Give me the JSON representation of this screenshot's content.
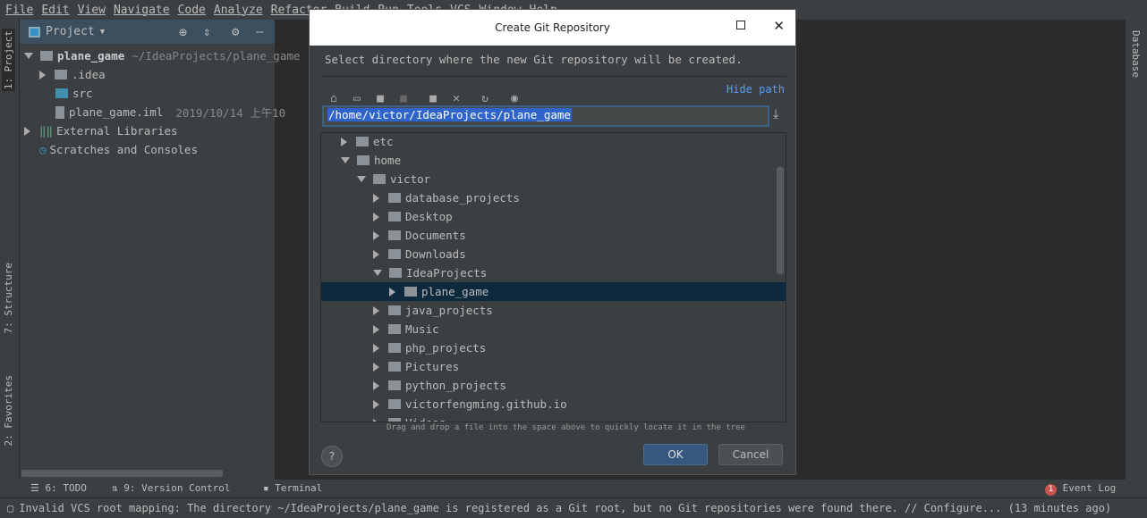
{
  "menu": [
    "File",
    "Edit",
    "View",
    "Navigate",
    "Code",
    "Analyze",
    "Refactor",
    "Build",
    "Run",
    "Tools",
    "VCS",
    "Window",
    "Help"
  ],
  "left_strip": {
    "project_tab": "1: Project",
    "structure_tab": "7: Structure",
    "favorites_tab": "2: Favorites"
  },
  "right_strip": {
    "database_tab": "Database"
  },
  "project_panel": {
    "title": "Project",
    "items": [
      {
        "label": "plane_game",
        "extra": "~/IdeaProjects/plane_game"
      },
      {
        "label": ".idea"
      },
      {
        "label": "src"
      },
      {
        "label": "plane_game.iml",
        "extra": "2019/10/14 上午10"
      },
      {
        "label": "External Libraries"
      },
      {
        "label": "Scratches and Consoles"
      }
    ]
  },
  "dialog": {
    "title": "Create Git Repository",
    "prompt": "Select directory where the new Git repository will be created.",
    "hide_path": "Hide path",
    "path": "/home/victor/IdeaProjects/plane_game",
    "tree": [
      "etc",
      "home",
      "victor",
      "database_projects",
      "Desktop",
      "Documents",
      "Downloads",
      "IdeaProjects",
      "plane_game",
      "java_projects",
      "Music",
      "php_projects",
      "Pictures",
      "python_projects",
      "victorfengming.github.io",
      "Videos"
    ],
    "hint": "Drag and drop a file into the space above to quickly locate it in the tree",
    "help": "?",
    "ok": "OK",
    "cancel": "Cancel"
  },
  "bottom_bar": {
    "todo": "6: TODO",
    "vcs": "9: Version Control",
    "terminal": "Terminal",
    "event_log": "Event Log",
    "event_count": "1"
  },
  "status": "Invalid VCS root mapping: The directory ~/IdeaProjects/plane_game is registered as a Git root, but no Git repositories were found there. // Configure... (13 minutes ago)",
  "colors": {
    "accent": "#2f65ca",
    "selection": "#0d293e",
    "ok_button": "#365880",
    "badge": "#c75450"
  }
}
